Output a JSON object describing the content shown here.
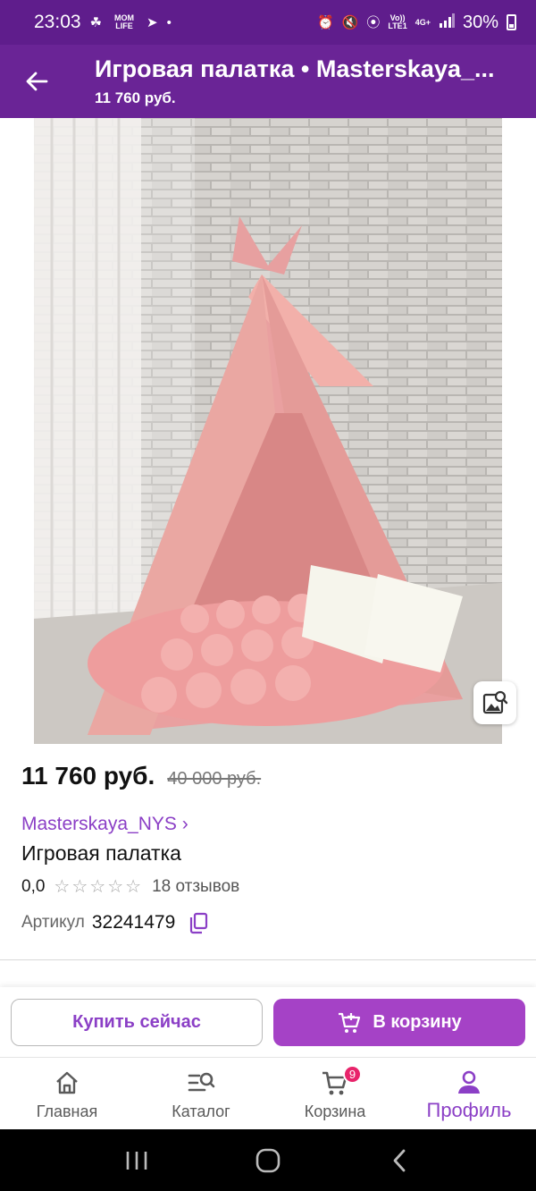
{
  "status_bar": {
    "time": "23:03",
    "mom_life": "MOM LIFE",
    "volte_top": "Vo))",
    "volte_bottom": "LTE1",
    "network": "4G+",
    "battery": "30%"
  },
  "app_bar": {
    "title": "Игровая палатка • Masterskaya_...",
    "subtitle": "11 760 руб."
  },
  "product": {
    "price": "11 760 руб.",
    "old_price": "40 000 руб.",
    "brand": "Masterskaya_NYS ›",
    "name": "Игровая палатка",
    "rating_value": "0,0",
    "stars": "☆☆☆☆☆",
    "reviews": "18 отзывов",
    "sku_label": "Артикул",
    "sku": "32241479"
  },
  "actions": {
    "buy_now": "Купить сейчас",
    "add_to_cart": "В корзину"
  },
  "bottom_nav": {
    "home": "Главная",
    "catalog": "Каталог",
    "cart": "Корзина",
    "cart_badge": "9",
    "profile": "Профиль"
  },
  "colors": {
    "status_bar": "#5f1d8c",
    "app_bar": "#6a2496",
    "accent": "#8b3fc6",
    "cart_button": "#a542c6",
    "badge": "#e8246b"
  }
}
